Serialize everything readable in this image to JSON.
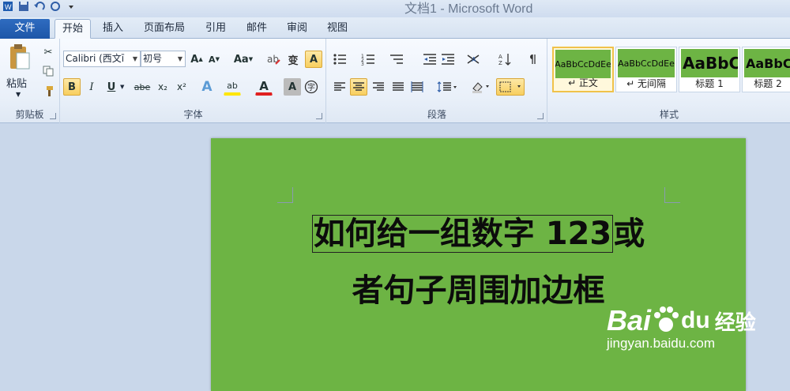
{
  "window": {
    "title": "文档1 - Microsoft Word"
  },
  "quick_access": [
    {
      "icon": "word-icon"
    },
    {
      "icon": "save-icon"
    },
    {
      "icon": "undo-icon"
    },
    {
      "icon": "redo-icon"
    },
    {
      "icon": "customize-icon"
    }
  ],
  "tabs": [
    {
      "label": "文件"
    },
    {
      "label": "开始"
    },
    {
      "label": "插入"
    },
    {
      "label": "页面布局"
    },
    {
      "label": "引用"
    },
    {
      "label": "邮件"
    },
    {
      "label": "审阅"
    },
    {
      "label": "视图"
    }
  ],
  "clipboard": {
    "paste_label": "粘贴",
    "group_label": "剪贴板"
  },
  "font": {
    "family_value": "Calibri (西文ī",
    "size_value": "初号",
    "grow_label": "A",
    "shrink_label": "A",
    "case_label": "Aa",
    "bold_label": "B",
    "italic_label": "I",
    "underline_label": "U",
    "strike_label": "abe",
    "subscript_label": "x₂",
    "superscript_label": "x²",
    "text_effect_label": "A",
    "highlight_label": "ab",
    "color_label": "A",
    "shading_label": "A",
    "group_label": "字体",
    "wen_label": "变",
    "a_border_label": "A"
  },
  "paragraph": {
    "group_label": "段落"
  },
  "styles": {
    "group_label": "样式",
    "items": [
      {
        "preview": "AaBbCcDdEe",
        "name": "↵ 正文"
      },
      {
        "preview": "AaBbCcDdEe",
        "name": "↵ 无间隔"
      },
      {
        "preview": "AaBbC",
        "name": "标题 1"
      },
      {
        "preview": "AaBbC",
        "name": "标题 2"
      }
    ]
  },
  "document": {
    "line1_boxed": "如何给一组数字 123",
    "line1_tail": "或",
    "line2": "者句子周围加边框"
  },
  "watermark": {
    "brand": "Bai",
    "brand2": "du",
    "cn": "经验",
    "url": "jingyan.baidu.com"
  },
  "colors": {
    "page_bg": "#6db444",
    "file_tab": "#2a67ba",
    "highlight_yellow": "#f8cf5f"
  }
}
